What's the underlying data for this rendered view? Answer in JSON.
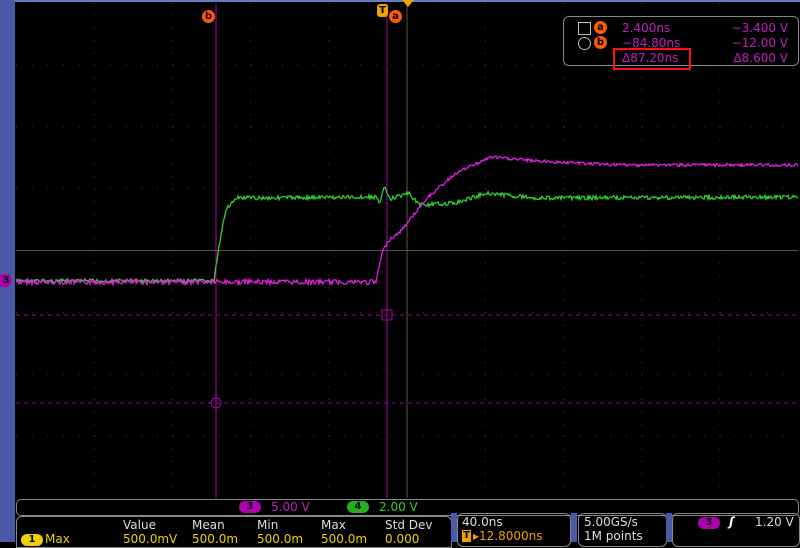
{
  "colors": {
    "ch3": "#d020d0",
    "ch4": "#30d030",
    "cursor": "#c000c0",
    "grid": "#555555",
    "accent": "#ff5a00",
    "frame": "#4a5aa8"
  },
  "markers": {
    "cursor_b": "b",
    "cursor_a": "a",
    "trigger": "T",
    "channel_marker": "3"
  },
  "cursor_readout": {
    "a": {
      "label": "a",
      "time": "2.400ns",
      "volt": "−3.400 V"
    },
    "b": {
      "label": "b",
      "time": "−84.80ns",
      "volt": "−12.00 V"
    },
    "delta": {
      "time": "Δ87.20ns",
      "volt": "Δ8.600 V"
    }
  },
  "channel_bar": {
    "ch3": {
      "label": "3",
      "scale": "5.00 V"
    },
    "ch4": {
      "label": "4",
      "scale": "2.00 V"
    }
  },
  "measurements": {
    "headers": [
      "Value",
      "Mean",
      "Min",
      "Max",
      "Std Dev"
    ],
    "rows": [
      {
        "source": "1",
        "name": "Max",
        "values": [
          "500.0mV",
          "500.0m",
          "500.0m",
          "500.0m",
          "0.000"
        ]
      }
    ]
  },
  "timebase": {
    "scale": "40.0ns",
    "trigger_pos": "▸12.8000ns",
    "trigger_icon": "T"
  },
  "acquisition": {
    "rate": "5.00GS/s",
    "length": "1M points"
  },
  "trigger": {
    "source": "3",
    "slope": "rising-edge-icon",
    "slope_glyph": "ʃ",
    "level": "1.20 V"
  }
}
